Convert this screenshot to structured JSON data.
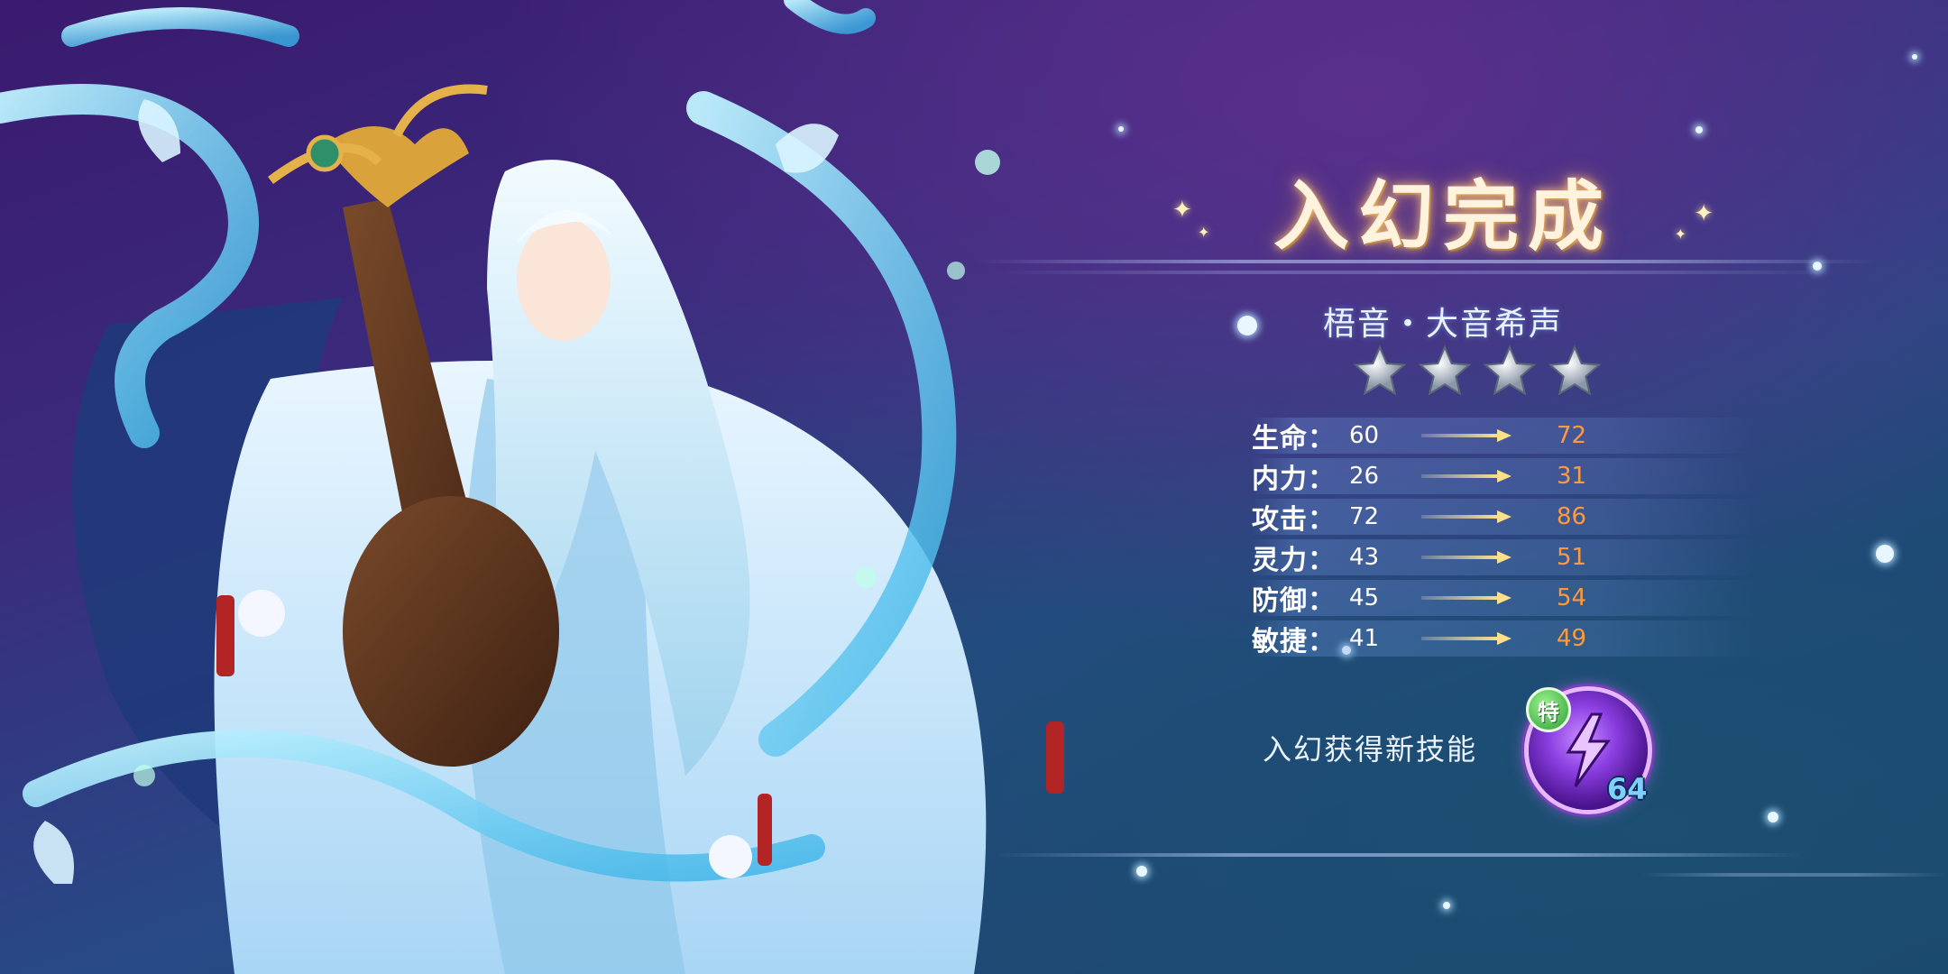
{
  "title": "入幻完成",
  "character": {
    "name": "梧音・大音希声",
    "star_count": 4
  },
  "stats": [
    {
      "label": "生命：",
      "old": "60",
      "new": "72"
    },
    {
      "label": "内力：",
      "old": "26",
      "new": "31"
    },
    {
      "label": "攻击：",
      "old": "72",
      "new": "86"
    },
    {
      "label": "灵力：",
      "old": "43",
      "new": "51"
    },
    {
      "label": "防御：",
      "old": "45",
      "new": "54"
    },
    {
      "label": "敏捷：",
      "old": "41",
      "new": "49"
    }
  ],
  "skill": {
    "label": "入幻获得新技能",
    "badge": "特",
    "level": "64",
    "icon": "purple-thunder-skill-icon"
  },
  "colors": {
    "accent_new_value": "#ff9a3c",
    "title_glow": "#ffb46a",
    "skill_purple": "#8a3ee0",
    "badge_green": "#2f9e37"
  }
}
